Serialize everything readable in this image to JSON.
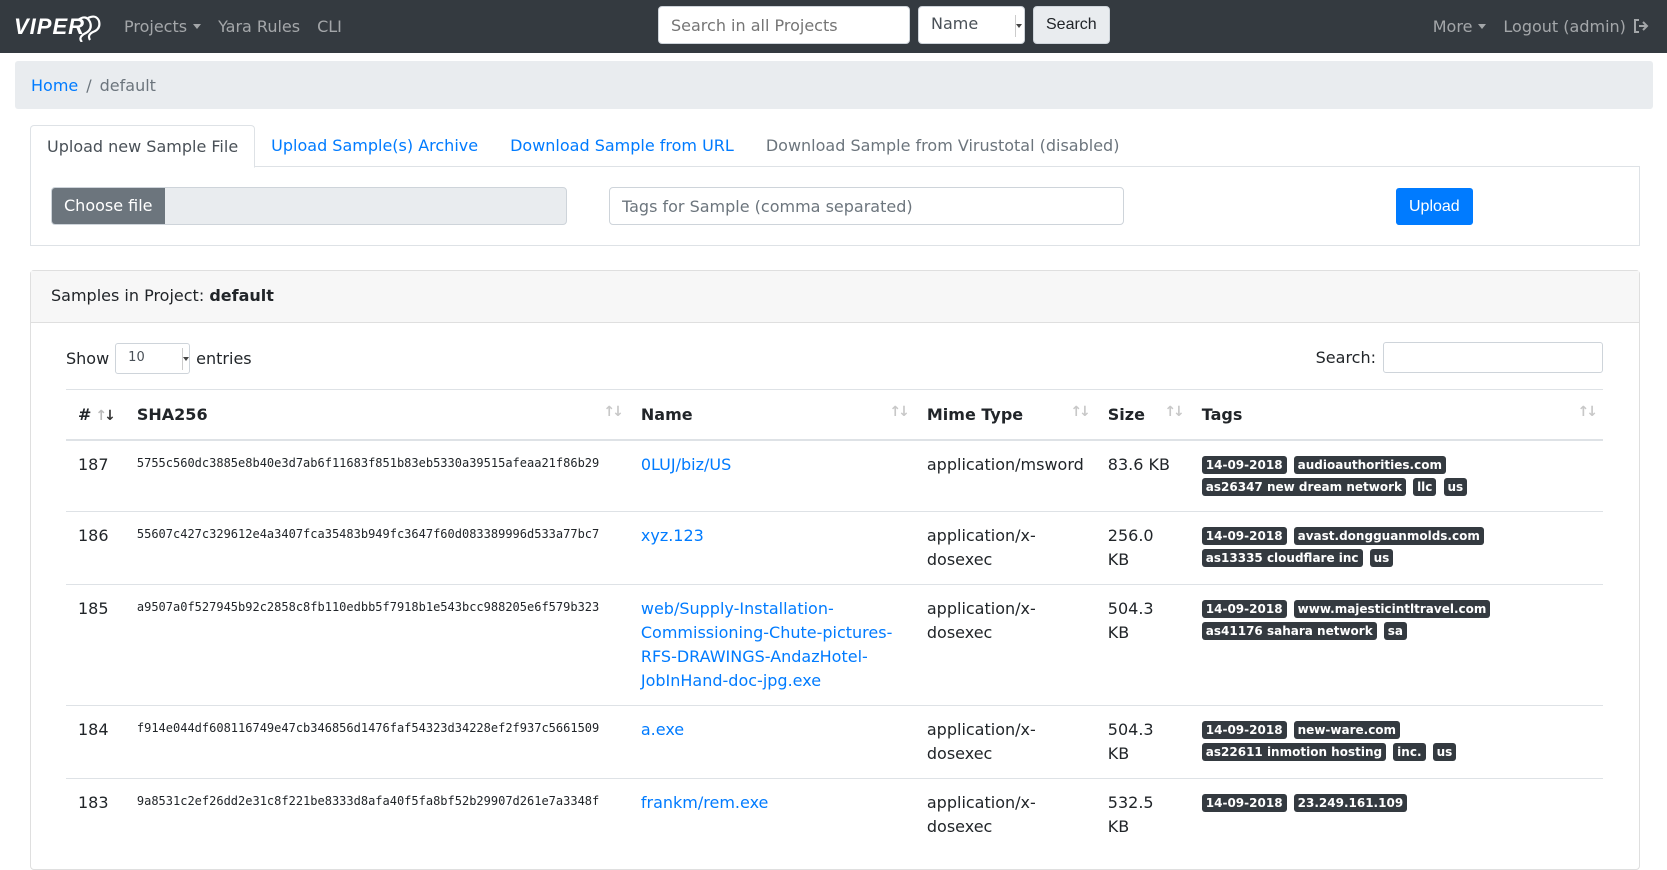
{
  "nav": {
    "logo": "VIPER",
    "projects": "Projects",
    "yara": "Yara Rules",
    "cli": "CLI",
    "search_placeholder": "Search in all Projects",
    "search_by": "Name",
    "search_button": "Search",
    "more": "More",
    "logout": "Logout (admin)"
  },
  "breadcrumb": {
    "home": "Home",
    "current": "default"
  },
  "tabs": [
    {
      "label": "Upload new Sample File"
    },
    {
      "label": "Upload Sample(s) Archive"
    },
    {
      "label": "Download Sample from URL"
    },
    {
      "label": "Download Sample from Virustotal (disabled)"
    }
  ],
  "upload": {
    "choose_file": "Choose file",
    "tags_placeholder": "Tags for Sample (comma separated)",
    "upload_button": "Upload"
  },
  "samples": {
    "header_prefix": "Samples in Project:",
    "project": "default",
    "show": "Show",
    "entries_value": "10",
    "entries": "entries",
    "search_label": "Search:",
    "columns": [
      "#",
      "SHA256",
      "Name",
      "Mime Type",
      "Size",
      "Tags"
    ],
    "rows": [
      {
        "id": "187",
        "sha": "5755c560dc3885e8b40e3d7ab6f11683f851b83eb5330a39515afeaa21f86b29",
        "name": "0LUJ/biz/US",
        "mime": "application/msword",
        "size": "83.6 KB",
        "tags": [
          "14-09-2018",
          "audioauthorities.com",
          "as26347 new dream network",
          "llc",
          "us"
        ]
      },
      {
        "id": "186",
        "sha": "55607c427c329612e4a3407fca35483b949fc3647f60d083389996d533a77bc7",
        "name": "xyz.123",
        "mime": "application/x-dosexec",
        "size": "256.0 KB",
        "tags": [
          "14-09-2018",
          "avast.dongguanmolds.com",
          "as13335 cloudflare inc",
          "us"
        ]
      },
      {
        "id": "185",
        "sha": "a9507a0f527945b92c2858c8fb110edbb5f7918b1e543bcc988205e6f579b323",
        "name": "web/Supply-Installation-Commissioning-Chute-pictures-RFS-DRAWINGS-AndazHotel-JobInHand-doc-jpg.exe",
        "mime": "application/x-dosexec",
        "size": "504.3 KB",
        "tags": [
          "14-09-2018",
          "www.majesticintltravel.com",
          "as41176 sahara network",
          "sa"
        ]
      },
      {
        "id": "184",
        "sha": "f914e044df608116749e47cb346856d1476faf54323d34228ef2f937c5661509",
        "name": "a.exe",
        "mime": "application/x-dosexec",
        "size": "504.3 KB",
        "tags": [
          "14-09-2018",
          "new-ware.com",
          "as22611 inmotion hosting",
          "inc.",
          "us"
        ]
      },
      {
        "id": "183",
        "sha": "9a8531c2ef26dd2e31c8f221be8333d8afa40f5fa8bf52b29907d261e7a3348f",
        "name": "frankm/rem.exe",
        "mime": "application/x-dosexec",
        "size": "532.5 KB",
        "tags": [
          "14-09-2018",
          "23.249.161.109"
        ]
      }
    ]
  }
}
